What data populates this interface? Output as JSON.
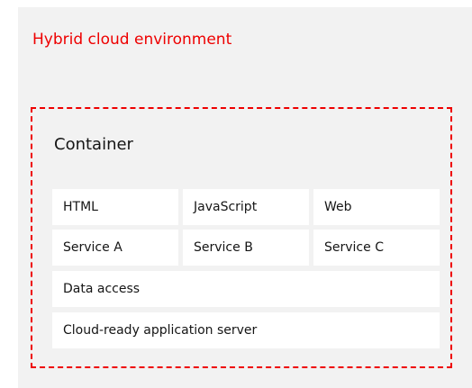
{
  "diagram": {
    "title": "Hybrid cloud environment",
    "container": {
      "title": "Container",
      "rows": [
        [
          "HTML",
          "JavaScript",
          "Web"
        ],
        [
          "Service A",
          "Service B",
          "Service C"
        ],
        [
          "Data access"
        ],
        [
          "Cloud-ready application server"
        ]
      ]
    }
  },
  "colors": {
    "accent": "#ee0000",
    "background": "#f2f2f2",
    "cell": "#ffffff",
    "text": "#151515"
  }
}
